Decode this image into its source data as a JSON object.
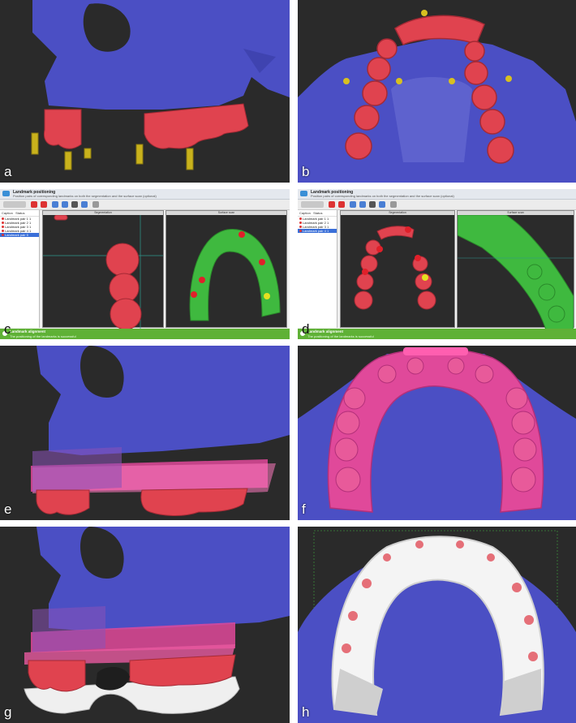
{
  "panels": {
    "a": {
      "label": "a"
    },
    "b": {
      "label": "b"
    },
    "c": {
      "label": "c"
    },
    "d": {
      "label": "d"
    },
    "e": {
      "label": "e"
    },
    "f": {
      "label": "f"
    },
    "g": {
      "label": "g"
    },
    "h": {
      "label": "h"
    }
  },
  "software": {
    "title": "Landmark positioning",
    "subtitle_c": "Position pairs of corresponding landmarks on both the segmentation and the surface scan (optional)",
    "subtitle_d": "Position pairs of corresponding landmarks on both the segmentation and the surface scan (optional)",
    "list_header_caption": "Caption",
    "list_header_status": "Status",
    "rows": [
      {
        "caption": "Landmark pair 1",
        "status": "1"
      },
      {
        "caption": "Landmark pair 2",
        "status": "1"
      },
      {
        "caption": "Landmark pair 3",
        "status": "1"
      },
      {
        "caption": "Landmark pair 4",
        "status": "1"
      },
      {
        "caption": "Landmark pair 5",
        "status": ""
      }
    ],
    "view_left_title": "Segmentation",
    "view_right_title": "Surface scan",
    "status_title": "Landmark alignment",
    "status_text": "The positioning of the landmarks is successful"
  },
  "colors": {
    "bone": "#4b4fc4",
    "teeth": "#e0434f",
    "implant": "#c9b21c",
    "guide": "#e0499a",
    "scan": "#3fb93f",
    "background": "#2a2a2a",
    "status_bar": "#5fb136"
  }
}
